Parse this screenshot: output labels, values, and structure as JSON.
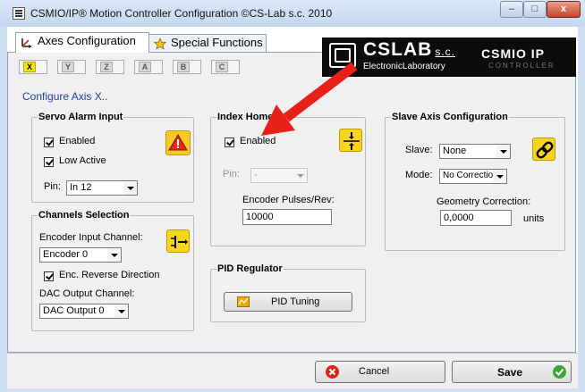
{
  "window": {
    "title": "CSMIO/IP® Motion Controller Configuration   ©CS-Lab s.c. 2010",
    "minimize": "–",
    "maximize": "□",
    "close": "x"
  },
  "tabs": [
    {
      "label": "Axes Configuration",
      "icon": "axes-icon"
    },
    {
      "label": "Special Functions",
      "icon": "star-icon"
    }
  ],
  "axis_tabs": [
    "X",
    "Y",
    "Z",
    "A",
    "B",
    "C"
  ],
  "logo": {
    "name": "CSLAB",
    "suffix": "s.c.",
    "sub": "ElectronicLaboratory",
    "product": "CSMIO IP",
    "product_sub": "CONTROLLER"
  },
  "configure_title": "Configure Axis X..",
  "servo_alarm": {
    "title": "Servo Alarm Input",
    "enabled_label": "Enabled",
    "enabled": true,
    "low_active_label": "Low Active",
    "low_active": true,
    "pin_label": "Pin:",
    "pin_value": "In 12",
    "icon": "warning-icon"
  },
  "channels": {
    "title": "Channels Selection",
    "encoder_label": "Encoder Input Channel:",
    "encoder_value": "Encoder 0",
    "reverse_label": "Enc. Reverse Direction",
    "reverse": true,
    "dac_label": "DAC Output Channel:",
    "dac_value": "DAC Output 0",
    "icon": "channels-icon"
  },
  "index_home": {
    "title": "Index Home",
    "enabled_label": "Enabled",
    "enabled": true,
    "pin_label": "Pin:",
    "pin_value": "-",
    "pulses_label": "Encoder Pulses/Rev:",
    "pulses_value": "10000",
    "icon": "index-home-icon"
  },
  "slave": {
    "title": "Slave Axis Configuration",
    "slave_label": "Slave:",
    "slave_value": "None",
    "mode_label": "Mode:",
    "mode_value": "No Correction",
    "geometry_label": "Geometry Correction:",
    "geometry_value": "0,0000",
    "units": "units",
    "icon": "link-icon"
  },
  "pid": {
    "title": "PID Regulator",
    "button": "PID Tuning"
  },
  "footer": {
    "cancel": "Cancel",
    "save": "Save"
  },
  "colors": {
    "accent_yellow": "#f7d51c",
    "annotation_arrow": "#e8201a",
    "configure_text": "#1b3f94"
  }
}
